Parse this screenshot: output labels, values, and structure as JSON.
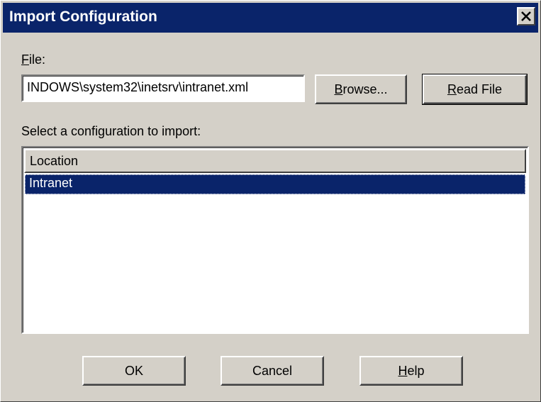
{
  "window": {
    "title": "Import Configuration",
    "close_icon": "close-icon"
  },
  "file": {
    "label_accel": "F",
    "label_rest": "ile:",
    "value": "INDOWS\\system32\\inetsrv\\intranet.xml"
  },
  "buttons": {
    "browse_accel": "B",
    "browse_rest": "rowse...",
    "read_accel": "R",
    "read_rest": "ead File",
    "ok": "OK",
    "cancel": "Cancel",
    "help_accel": "H",
    "help_rest": "elp"
  },
  "select_label": "Select a configuration to import:",
  "list": {
    "columns": [
      "Location"
    ],
    "rows": [
      {
        "location": "Intranet",
        "selected": true
      }
    ]
  },
  "colors": {
    "titlebar": "#0a246a",
    "face": "#d4d0c8",
    "selection": "#0a246a"
  }
}
